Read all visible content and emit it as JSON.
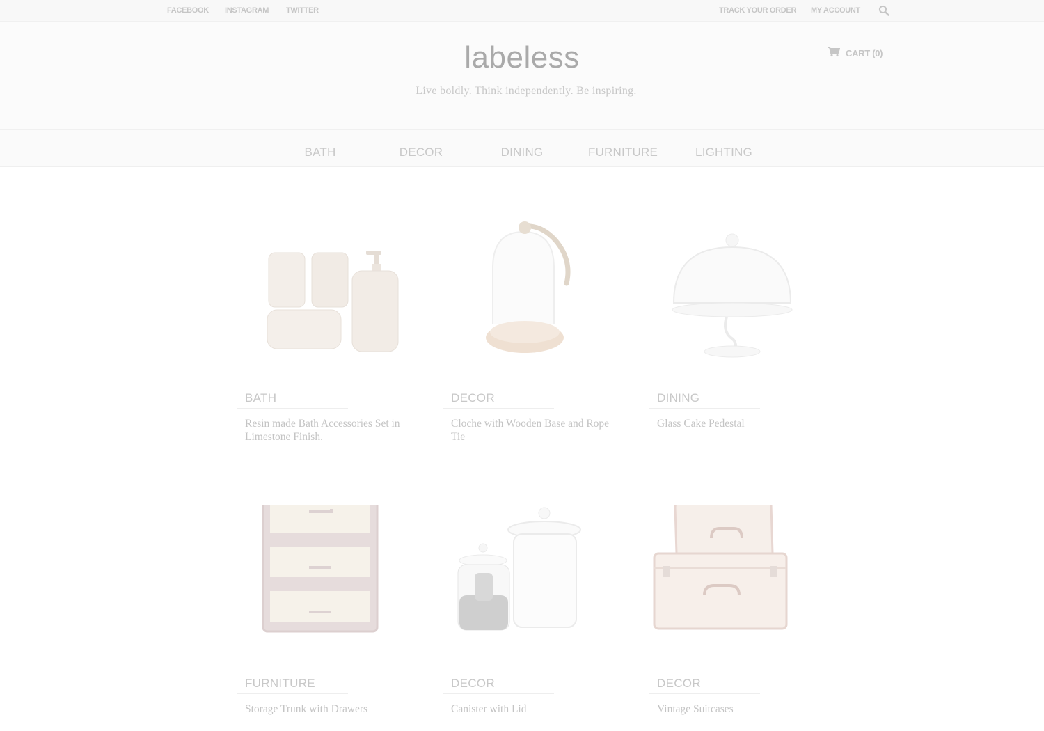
{
  "topbar": {
    "social": [
      "FACEBOOK",
      "INSTAGRAM",
      "TWITTER"
    ],
    "track_order": "TRACK YOUR ORDER",
    "my_account": "MY ACCOUNT",
    "search_icon": "search-icon"
  },
  "header": {
    "logo": "labeless",
    "tagline": "Live boldly. Think independently. Be inspiring.",
    "cart_label": "CART (0)",
    "cart_icon": "shopping-cart-icon"
  },
  "nav": {
    "items": [
      "BATH",
      "DECOR",
      "DINING",
      "FURNITURE",
      "LIGHTING"
    ]
  },
  "products": [
    {
      "category": "BATH",
      "name": "Resin made Bath Accessories Set in Limestone Finish."
    },
    {
      "category": "DECOR",
      "name": "Cloche with Wooden Base and Rope Tie"
    },
    {
      "category": "DINING",
      "name": "Glass Cake Pedestal"
    },
    {
      "category": "FURNITURE",
      "name": "Storage Trunk with  Drawers"
    },
    {
      "category": "DECOR",
      "name": "Canister with Lid"
    },
    {
      "category": "DECOR",
      "name": "Vintage Suitcases"
    }
  ]
}
